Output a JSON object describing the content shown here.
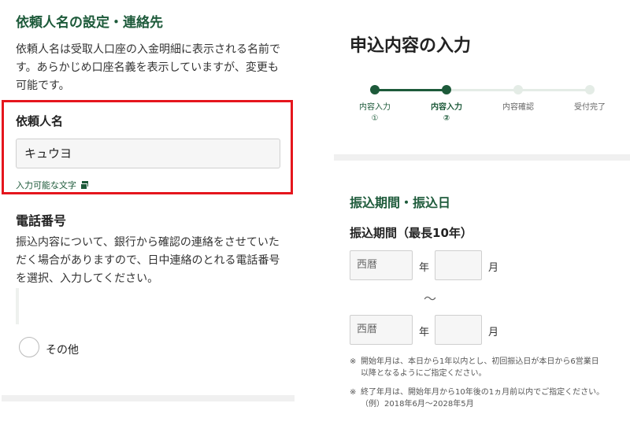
{
  "left": {
    "section_title": "依頼人名の設定・連絡先",
    "description": [
      "依頼人名は受取人口座の入金明細に表示される名前で",
      "す。あらかじめ口座名義を表示していますが、変更も",
      "可能です。"
    ],
    "requester_label": "依頼人名",
    "requester_value": "キュウヨ",
    "allowed_chars_link": "入力可能な文字",
    "phone_title": "電話番号",
    "phone_description": [
      "振込内容について、銀行から確認の連絡をさせていた",
      "だく場合がありますので、日中連絡のとれる電話番号",
      "を選択、入力してください。"
    ],
    "other_option": "その他"
  },
  "right": {
    "page_title": "申込内容の入力",
    "steps": [
      {
        "line1": "内容入力",
        "line2": "①",
        "state": "done"
      },
      {
        "line1": "内容入力",
        "line2": "②",
        "state": "current"
      },
      {
        "line1": "内容確認",
        "line2": "",
        "state": "todo"
      },
      {
        "line1": "受付完了",
        "line2": "",
        "state": "todo"
      }
    ],
    "section_title": "振込期間・振込日",
    "period_label": "振込期間（最長10年）",
    "era_placeholder": "西暦",
    "year_unit": "年",
    "month_unit": "月",
    "range_mark": "～",
    "note1_mark": "※",
    "note1_line1": "開始年月は、本日から1年以内とし、初回振込日が本日から6営業日",
    "note1_line2": "以降となるようにご指定ください。",
    "note2_mark": "※",
    "note2_line1": "終了年月は、開始年月から10年後の1ヵ月前以内でご指定ください。",
    "note2_line2": "（例）2018年6月～2028年5月"
  },
  "colors": {
    "brand_green": "#1d5a3a",
    "highlight_red": "#e5161d",
    "step_inactive": "#e4ece6"
  }
}
